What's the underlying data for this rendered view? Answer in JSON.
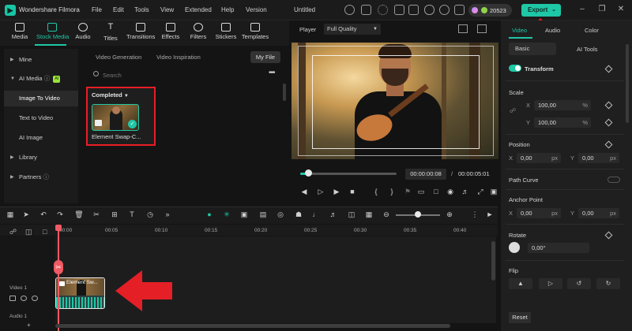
{
  "app": {
    "name": "Wondershare Filmora",
    "document_title": "Untitled",
    "menu": [
      "File",
      "Edit",
      "Tools",
      "View",
      "Extended",
      "Help",
      "Version"
    ],
    "credits": "20523",
    "export_label": "Export",
    "accent": "#1ec7a6"
  },
  "media_tabs": [
    {
      "label": "Media",
      "icon": "media-icon"
    },
    {
      "label": "Stock Media",
      "icon": "stock-media-icon",
      "active": true
    },
    {
      "label": "Audio",
      "icon": "music-icon"
    },
    {
      "label": "Titles",
      "icon": "titles-icon"
    },
    {
      "label": "Transitions",
      "icon": "transitions-icon"
    },
    {
      "label": "Effects",
      "icon": "effects-icon"
    },
    {
      "label": "Filters",
      "icon": "filters-icon"
    },
    {
      "label": "Stickers",
      "icon": "stickers-icon"
    },
    {
      "label": "Templates",
      "icon": "templates-icon"
    }
  ],
  "sidebar": {
    "items": [
      {
        "label": "Mine"
      },
      {
        "label": "AI Media",
        "badge": "AI"
      },
      {
        "label": "Image To Video",
        "active": true
      },
      {
        "label": "Text to Video"
      },
      {
        "label": "AI Image"
      },
      {
        "label": "Library"
      },
      {
        "label": "Partners"
      }
    ]
  },
  "browser": {
    "sub_tabs": [
      "Video Generation",
      "Video Inspiration"
    ],
    "my_file": "My File",
    "search_placeholder": "Search",
    "completed_label": "Completed",
    "item_name": "Element Swap-C..."
  },
  "player": {
    "label": "Player",
    "quality": "Full Quality",
    "current_time": "00:00:00:08",
    "separator": "/",
    "total_time": "00:00:05:01",
    "progress": 0.05
  },
  "timeline": {
    "ruler": [
      "00:00",
      "00:05",
      "00:10",
      "00:15",
      "00:20",
      "00:25",
      "00:30",
      "00:35",
      "00:40"
    ],
    "video_track": "Video 1",
    "audio_track": "Audio 1",
    "clip_label": "Element Sw...",
    "zoom_level": 0.45
  },
  "right_panel": {
    "tabs": [
      "Video",
      "Audio",
      "Color"
    ],
    "sub_tabs": [
      "Basic",
      "AI Tools"
    ],
    "transform_label": "Transform",
    "scale_label": "Scale",
    "x_axis": "X",
    "y_axis": "Y",
    "scale_x": "100,00",
    "scale_y": "100,00",
    "percent": "%",
    "position_label": "Position",
    "pos_x": "0,00",
    "pos_y": "0,00",
    "px": "px",
    "path_curve": "Path Curve",
    "anchor_label": "Anchor Point",
    "anchor_x": "0,00",
    "anchor_y": "0,00",
    "rotate_label": "Rotate",
    "rotate_value": "0,00°",
    "flip_label": "Flip",
    "reset_label": "Reset"
  }
}
